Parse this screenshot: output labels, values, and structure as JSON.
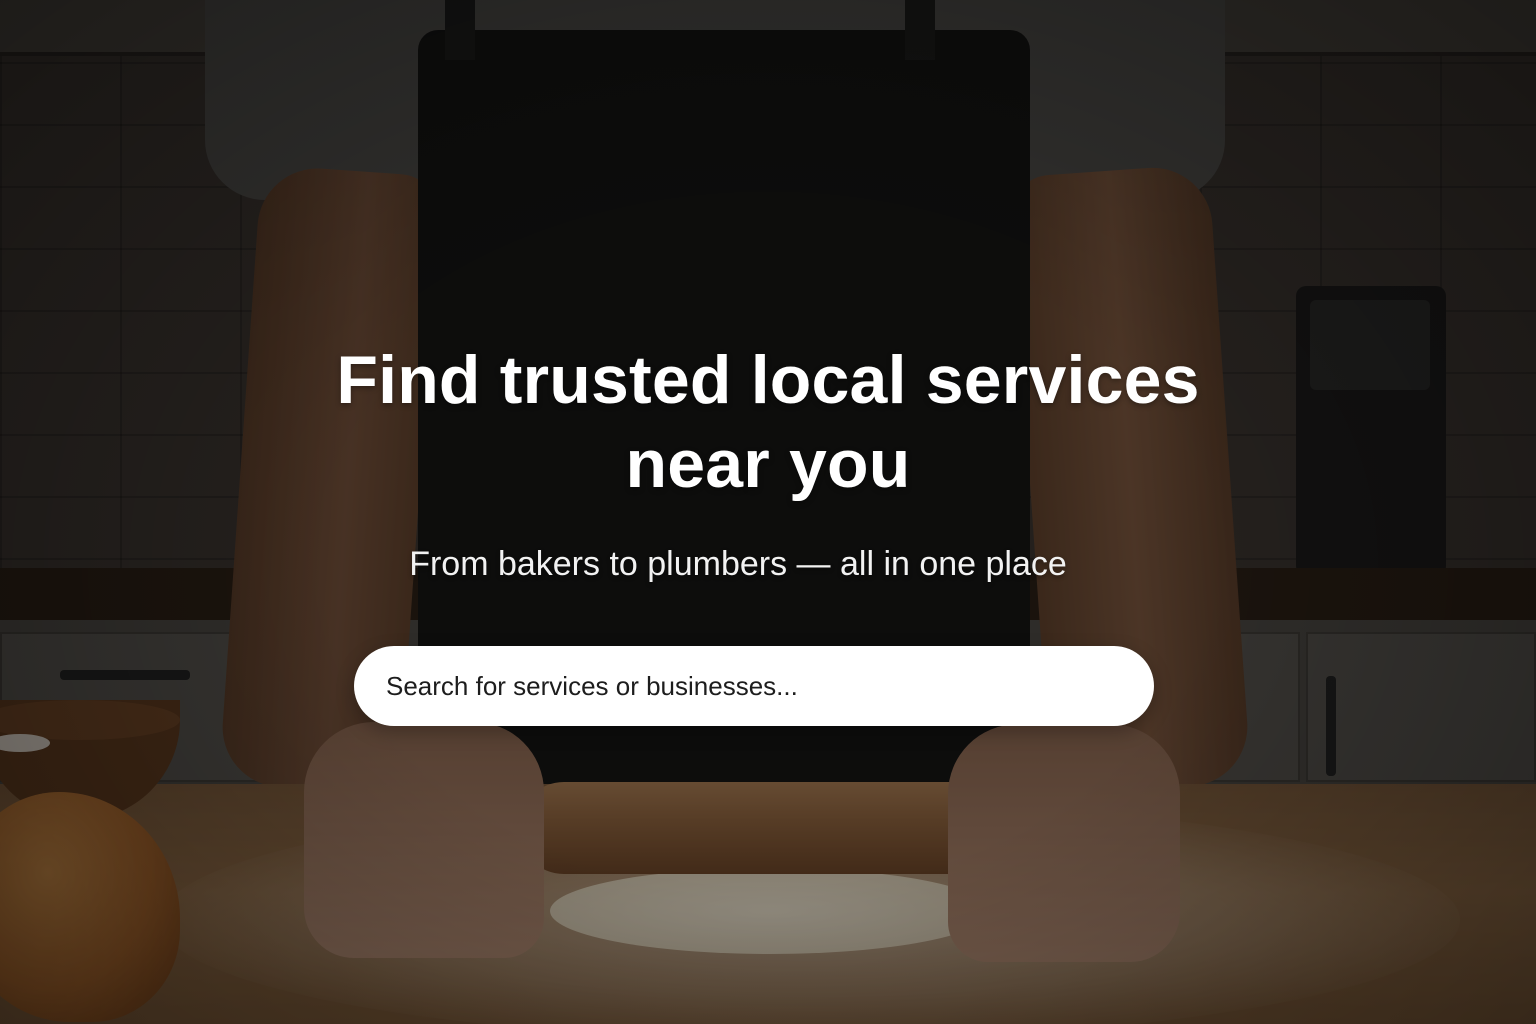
{
  "hero": {
    "title_line_1": "Find trusted local services",
    "title_line_2": "near you",
    "subtitle": "From bakers to plumbers — all in one place"
  },
  "search": {
    "placeholder": "Search for services or businesses...",
    "value": ""
  },
  "background": {
    "image_description_icon": "baker-rolling-dough-photo",
    "overlay_color": "#000000"
  },
  "colors": {
    "text": "#ffffff",
    "search_background": "#ffffff",
    "search_text": "#1d1d1d"
  }
}
